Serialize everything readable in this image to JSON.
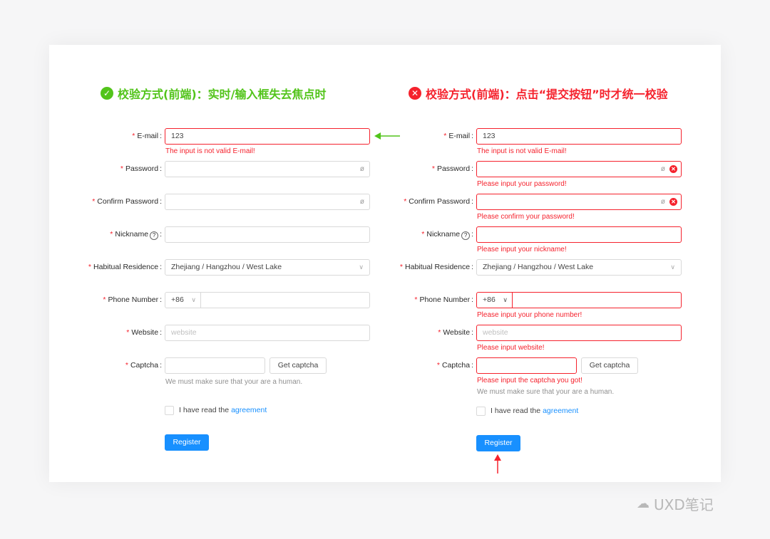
{
  "left_title": {
    "icon": "check-circle-icon",
    "text": "校验方式(前端)：实时/输入框失去焦点时"
  },
  "right_title": {
    "icon": "close-circle-icon",
    "text": "校验方式(前端)：点击“提交按钮”时才统一校验"
  },
  "labels": {
    "email": "E-mail",
    "password": "Password",
    "confirm_password": "Confirm Password",
    "nickname": "Nickname",
    "residence": "Habitual Residence",
    "phone": "Phone Number",
    "website": "Website",
    "captcha": "Captcha",
    "required_mark": "*",
    "colon": ":"
  },
  "nickname_help_icon": "question-circle-icon",
  "left_form": {
    "email_value": "123",
    "email_error": "The input is not valid E-mail!",
    "password_value": "",
    "confirm_value": "",
    "nickname_value": "",
    "residence_value": "Zhejiang / Hangzhou / West Lake",
    "phone_prefix": "+86",
    "phone_value": "",
    "website_placeholder": "website",
    "captcha_value": "",
    "captcha_button": "Get captcha",
    "captcha_help": "We must make sure that your are a human.",
    "agreement_prefix": "I have read the",
    "agreement_link": "agreement",
    "register_button": "Register"
  },
  "right_form": {
    "email_value": "123",
    "email_error": "The input is not valid E-mail!",
    "password_error": "Please input your password!",
    "confirm_error": "Please confirm your password!",
    "nickname_error": "Please input your nickname!",
    "residence_value": "Zhejiang / Hangzhou / West Lake",
    "phone_prefix": "+86",
    "phone_error": "Please input your phone number!",
    "website_placeholder": "website",
    "website_error": "Please input website!",
    "captcha_button": "Get captcha",
    "captcha_error": "Please input the captcha you got!",
    "captcha_help": "We must make sure that your are a human.",
    "agreement_prefix": "I have read the",
    "agreement_link": "agreement",
    "register_button": "Register"
  },
  "icons": {
    "eye_invisible": "eye-invisible-icon",
    "clear_error": "close-circle-icon",
    "dropdown": "chevron-down-icon",
    "pointer_left": "arrow-left-icon",
    "pointer_up": "arrow-up-icon"
  },
  "colors": {
    "success": "#52c41a",
    "error": "#f5222d",
    "primary": "#1890ff",
    "border": "#d9d9d9"
  },
  "watermark": {
    "text": "UXD笔记"
  }
}
